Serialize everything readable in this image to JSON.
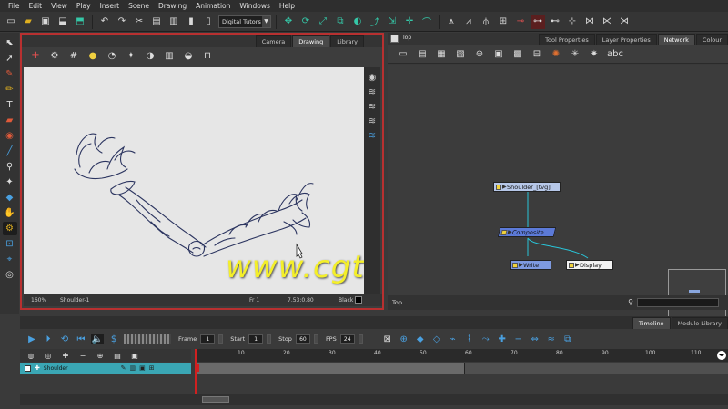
{
  "menu": [
    "File",
    "Edit",
    "View",
    "Play",
    "Insert",
    "Scene",
    "Drawing",
    "Animation",
    "Windows",
    "Help"
  ],
  "toolbar": {
    "workspace": "Digital Tutors",
    "icons": [
      "new-scene-icon",
      "open-icon",
      "save-icon",
      "import-icon",
      "undo-icon",
      "redo-icon",
      "cut-icon",
      "copy-icon",
      "paste-icon"
    ]
  },
  "drawing_view": {
    "tabs": [
      "Camera",
      "Drawing",
      "Library"
    ],
    "active_tab": "Drawing",
    "status": {
      "zoom": "160%",
      "drawing": "Shoulder-1",
      "frame": "Fr 1",
      "coords": "7.53:0.80",
      "color": "Black"
    }
  },
  "watermark": "www.cgtsj.com",
  "network_view": {
    "breadcrumb": "Top",
    "tabs": [
      "Tool Properties",
      "Layer Properties",
      "Network",
      "Colour"
    ],
    "active_tab": "Network",
    "nodes": {
      "shoulder": "Shoulder_[tvg]",
      "composite": "Composite",
      "write": "Write",
      "display": "Display"
    },
    "status_label": "Top"
  },
  "timeline": {
    "tabs": [
      "Timeline",
      "Module Library"
    ],
    "active_tab": "Timeline",
    "frame_label": "Frame",
    "frame_value": "1",
    "start_label": "Start",
    "start_value": "1",
    "stop_label": "Stop",
    "stop_value": "60",
    "fps_label": "FPS",
    "fps_value": "24",
    "layer_name": "Shoulder",
    "ruler_ticks": [
      "10",
      "20",
      "30",
      "40",
      "50",
      "60",
      "70",
      "80",
      "90",
      "100",
      "110"
    ]
  }
}
